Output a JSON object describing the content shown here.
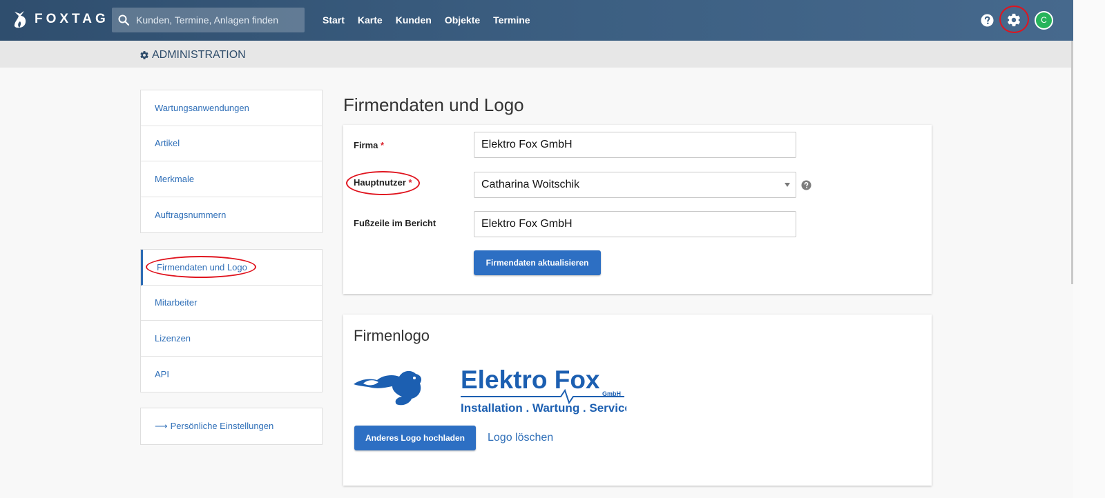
{
  "topbar": {
    "brand": "FOXTAG",
    "search_placeholder": "Kunden, Termine, Anlagen finden",
    "nav": [
      "Start",
      "Karte",
      "Kunden",
      "Objekte",
      "Termine"
    ],
    "avatar_initial": "C"
  },
  "subheader": {
    "title": "ADMINISTRATION"
  },
  "menu": {
    "group1": [
      "Wartungsanwendungen",
      "Artikel",
      "Merkmale",
      "Auftragsnummern"
    ],
    "group2": [
      "Firmendaten und Logo",
      "Mitarbeiter",
      "Lizenzen",
      "API"
    ],
    "group3": [
      "Persönliche Einstellungen"
    ],
    "active": "Firmendaten und Logo"
  },
  "main": {
    "title": "Firmendaten und Logo",
    "form": {
      "firma_label": "Firma",
      "firma_value": "Elektro Fox GmbH",
      "hauptnutzer_label": "Hauptnutzer",
      "hauptnutzer_value": "Catharina Woitschik",
      "fusszeile_label": "Fußzeile im Bericht",
      "fusszeile_value": "Elektro Fox GmbH",
      "required_mark": "*",
      "submit_label": "Firmendaten aktualisieren"
    },
    "logo_card": {
      "title": "Firmenlogo",
      "logo_text_main": "Elektro Fox",
      "logo_text_suffix": "GmbH",
      "logo_tagline": "Installation . Wartung . Service",
      "upload_label": "Anderes Logo hochladen",
      "delete_label": "Logo löschen"
    }
  },
  "colors": {
    "topbar": "#3c5f82",
    "accent": "#2d6fc3",
    "highlight": "#e0141e",
    "avatar": "#27b45b"
  }
}
